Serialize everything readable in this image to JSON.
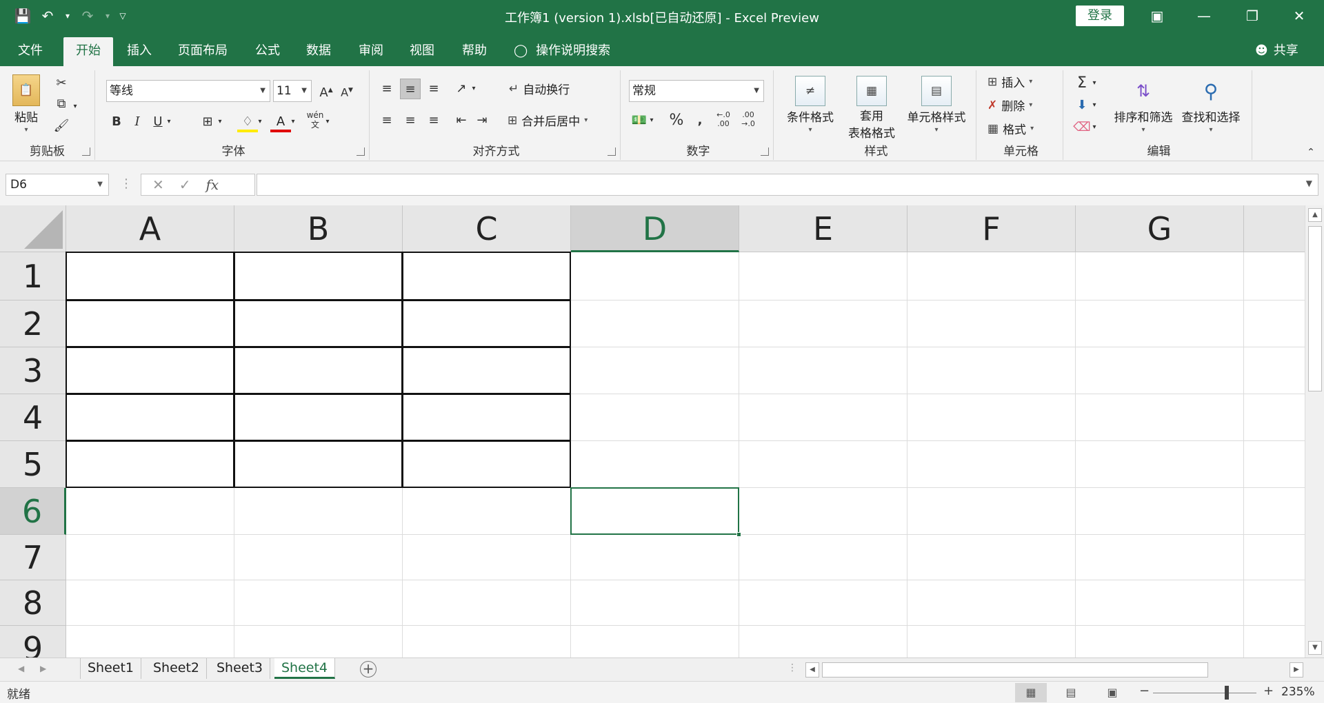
{
  "titlebar": {
    "title": "工作簿1 (version 1).xlsb[已自动还原]  -  Excel Preview",
    "login": "登录"
  },
  "menu": {
    "tabs": [
      {
        "label": "文件"
      },
      {
        "label": "开始"
      },
      {
        "label": "插入"
      },
      {
        "label": "页面布局"
      },
      {
        "label": "公式"
      },
      {
        "label": "数据"
      },
      {
        "label": "审阅"
      },
      {
        "label": "视图"
      },
      {
        "label": "帮助"
      }
    ],
    "active": "开始",
    "search_hint": "操作说明搜索",
    "share": "共享"
  },
  "ribbon": {
    "clipboard": {
      "label": "剪贴板",
      "paste": "粘贴"
    },
    "font": {
      "label": "字体",
      "font_name": "等线",
      "font_size": "11",
      "wen": "wén"
    },
    "alignment": {
      "label": "对齐方式",
      "wrap_text": "自动换行",
      "merge_center": "合并后居中"
    },
    "number": {
      "label": "数字",
      "format": "常规"
    },
    "styles": {
      "label": "样式",
      "conditional": "条件格式",
      "table_fmt_1": "套用",
      "table_fmt_2": "表格格式",
      "cell_styles": "单元格样式"
    },
    "cells": {
      "label": "单元格",
      "insert": "插入",
      "delete": "删除",
      "format": "格式"
    },
    "editing": {
      "label": "编辑",
      "sort_filter": "排序和筛选",
      "find_select": "查找和选择"
    }
  },
  "formula_bar": {
    "name_box": "D6",
    "value": ""
  },
  "grid": {
    "columns": [
      "A",
      "B",
      "C",
      "D",
      "E",
      "F",
      "G"
    ],
    "rows": [
      "1",
      "2",
      "3",
      "4",
      "5",
      "6",
      "7",
      "8",
      "9"
    ],
    "active_cell": "D6",
    "selected_column": "D",
    "selected_row": "6",
    "bordered_range": "A1:C5"
  },
  "sheets": {
    "tabs": [
      "Sheet1",
      "Sheet2",
      "Sheet3",
      "Sheet4"
    ],
    "active": "Sheet4"
  },
  "status": {
    "text": "就绪",
    "zoom": "235%"
  },
  "colors": {
    "brand": "#217346",
    "ribbon_bg": "#f3f3f3"
  }
}
